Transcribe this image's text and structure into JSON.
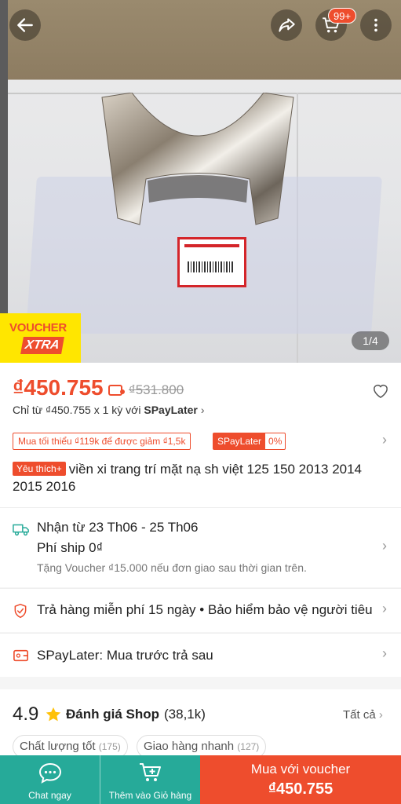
{
  "colors": {
    "brand": "#ee4d2d",
    "teal": "#26aa99",
    "voucher_yellow": "#ffe600"
  },
  "header": {
    "back_icon": "arrow-left-icon",
    "share_icon": "share-icon",
    "cart_icon": "cart-icon",
    "cart_badge": "99+",
    "more_icon": "more-vertical-icon"
  },
  "gallery": {
    "voucher_line1": "VOUCHER",
    "voucher_line2": "XTRA",
    "counter": "1/4"
  },
  "price": {
    "current": "₫450.755",
    "original": "₫531.800",
    "installment_prefix": "Chỉ từ ₫450.755 x 1 kỳ với ",
    "installment_brand": "SPayLater",
    "tag_min": "Mua tối thiểu ₫119k để được giảm ₫1,5k",
    "tag_spl_name": "SPayLater",
    "tag_spl_rate": "0%"
  },
  "product": {
    "fav_badge": "Yêu thích+",
    "title": "viền xi trang trí mặt nạ sh việt 125 150 2013 2014 2015 2016"
  },
  "shipping": {
    "delivery": "Nhận từ 23 Th06 - 25 Th06",
    "fee": "Phí ship 0₫",
    "voucher_note": "Tặng Voucher ₫15.000 nếu đơn giao sau thời gian trên."
  },
  "returns": {
    "text": "Trả hàng miễn phí 15 ngày  •  Bảo hiểm bảo vệ người tiêu dùng"
  },
  "spaylater": {
    "text": "SPayLater: Mua trước trả sau"
  },
  "rating": {
    "score": "4.9",
    "label": "Đánh giá Shop",
    "count": "(38,1k)",
    "see_all": "Tất cả",
    "chips": [
      {
        "label": "Chất lượng tốt",
        "count": "(175)"
      },
      {
        "label": "Giao hàng nhanh",
        "count": "(127)"
      }
    ]
  },
  "bottom_bar": {
    "chat_label": "Chat ngay",
    "cart_label": "Thêm vào Giỏ hàng",
    "buy_line1": "Mua với voucher",
    "buy_line2": "₫450.755"
  }
}
